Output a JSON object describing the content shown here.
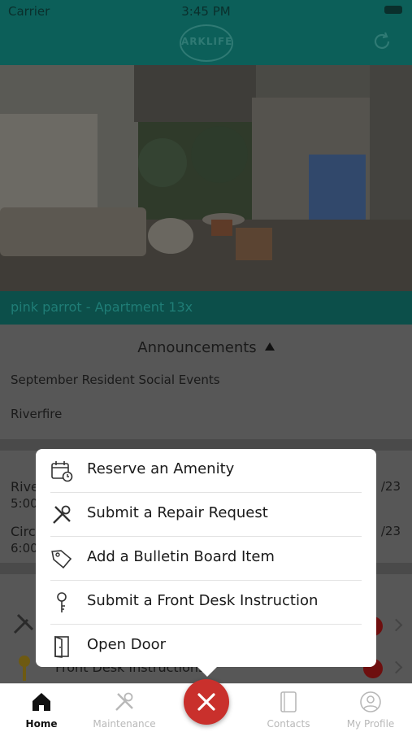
{
  "status_bar": {
    "carrier": "Carrier",
    "time": "3:45 PM"
  },
  "header": {
    "logo_text": "ARKLIFE"
  },
  "unit_bar": {
    "label": "pink parrot - Apartment 13x"
  },
  "announcements": {
    "title": "Announcements",
    "items": [
      "September Resident Social Events",
      "Riverfire"
    ]
  },
  "events": [
    {
      "title": "Rive",
      "sub": "5:00",
      "date": "/23"
    },
    {
      "title": "Circu",
      "sub": "6:00",
      "date": "/23"
    }
  ],
  "quick_links": [
    {
      "label": "Front Desk Instructions"
    }
  ],
  "action_menu": {
    "items": [
      {
        "label": "Reserve an Amenity",
        "icon": "calendar-clock-icon"
      },
      {
        "label": "Submit a Repair Request",
        "icon": "tools-icon"
      },
      {
        "label": "Add a Bulletin Board Item",
        "icon": "tag-icon"
      },
      {
        "label": "Submit a Front Desk Instruction",
        "icon": "key-icon"
      },
      {
        "label": "Open Door",
        "icon": "door-icon"
      }
    ]
  },
  "tabbar": {
    "tabs": [
      {
        "label": "Home",
        "icon": "home-icon"
      },
      {
        "label": "Maintenance",
        "icon": "tools-icon"
      },
      {
        "label": "Contacts",
        "icon": "contacts-icon"
      },
      {
        "label": "My Profile",
        "icon": "profile-icon"
      }
    ]
  },
  "colors": {
    "header": "#0c5f59",
    "fab": "#c9302c"
  }
}
